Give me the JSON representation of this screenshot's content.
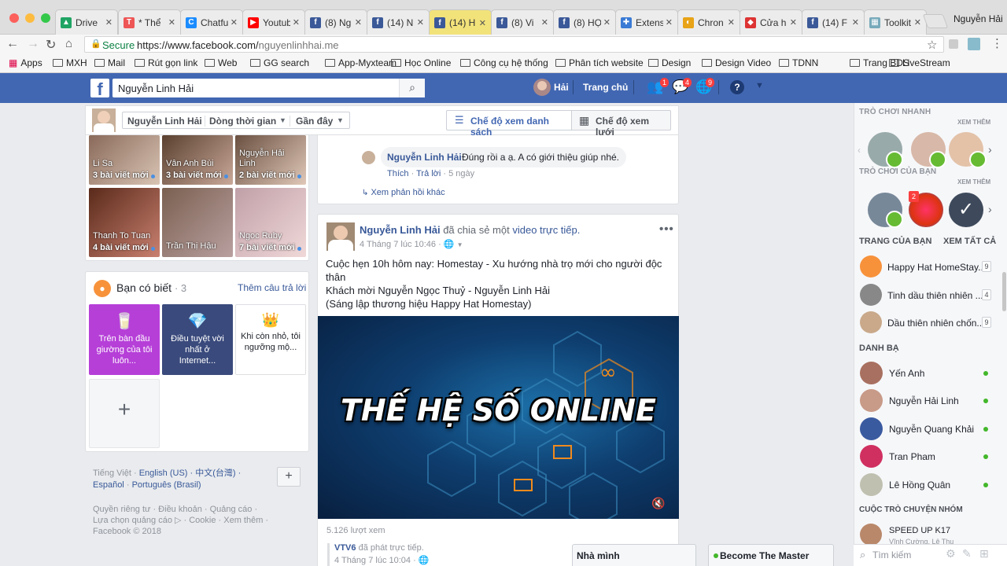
{
  "tabs": [
    {
      "label": "Drive",
      "color": "#1fa463",
      "glyph": "▲"
    },
    {
      "label": "* Thể",
      "color": "#e55",
      "glyph": "T"
    },
    {
      "label": "Chatfu",
      "color": "#1a8cff",
      "glyph": "C"
    },
    {
      "label": "Youtub",
      "color": "#f00",
      "glyph": "▶"
    },
    {
      "label": "(8) Ng",
      "color": "#3b5998",
      "glyph": "f"
    },
    {
      "label": "(14) N",
      "color": "#3b5998",
      "glyph": "f"
    },
    {
      "label": "(14) H",
      "color": "#3b5998",
      "glyph": "f"
    },
    {
      "label": "(8) Vi",
      "color": "#3b5998",
      "glyph": "f"
    },
    {
      "label": "(8) HỌ",
      "color": "#3b5998",
      "glyph": "f"
    },
    {
      "label": "Extens",
      "color": "#3a7bd5",
      "glyph": "✚"
    },
    {
      "label": "Chron",
      "color": "#e8a317",
      "glyph": "◐"
    },
    {
      "label": "Cửa h",
      "color": "#d33",
      "glyph": "◆"
    },
    {
      "label": "(14) F",
      "color": "#3b5998",
      "glyph": "f"
    },
    {
      "label": "Toolkit",
      "color": "#7ab",
      "glyph": "▦"
    }
  ],
  "profile_name": "Nguyễn Hải",
  "url": {
    "secure": "Secure",
    "prefix": "https://www.facebook.com/",
    "path": "nguyenlinhhai.me"
  },
  "bookmarks": [
    "Apps",
    "MXH",
    "Mail",
    "Rút gọn link",
    "Web",
    "GG search",
    "App-Myxteam",
    "Học Online",
    "Công cụ hệ thống",
    "Phân tích website",
    "Design",
    "Design Video",
    "TDNN",
    "Trang BDS",
    "LiveStream"
  ],
  "fb": {
    "search_value": "Nguyễn Linh Hải",
    "user": "Hải",
    "home": "Trang chủ",
    "badges": {
      "friends": "1",
      "messages": "4",
      "notifications": "9"
    }
  },
  "timeline": {
    "name": "Nguyễn Linh Hải",
    "filter": "Dòng thời gian",
    "sort": "Gần đây",
    "list_view": "Chế độ xem danh sách",
    "grid_view": "Chế độ xem lưới"
  },
  "friends": [
    {
      "name": "Li Sa",
      "posts": "3 bài viết mới"
    },
    {
      "name": "Vân Anh Bùi",
      "posts": "3 bài viết mới"
    },
    {
      "name": "Nguyễn Hải Linh",
      "posts": "2 bài viết mới"
    },
    {
      "name": "Thanh To Tuan",
      "posts": "4 bài viết mới"
    },
    {
      "name": "Trần Thị Hậu",
      "posts": ""
    },
    {
      "name": "Ngọc Ruby",
      "posts": "7 bài viết mới"
    }
  ],
  "ask": {
    "title": "Bạn có biết",
    "count": "· 3",
    "more": "Thêm câu trả lời",
    "cards": [
      "Trên bàn đầu giường của tôi luôn...",
      "Điều tuyệt vời nhất ở Internet...",
      "Khi còn nhỏ, tôi ngưỡng mộ..."
    ]
  },
  "languages": {
    "current": "Tiếng Việt ·",
    "list": [
      "English (US) ·",
      "中文(台灣) ·",
      "Español",
      "Português (Brasil)"
    ]
  },
  "footer": {
    "line1": "Quyền riêng tư · Điều khoản · Quảng cáo ·",
    "line2": "Lựa chọn quảng cáo ▷ · Cookie · Xem thêm ·",
    "copyright": "Facebook © 2018"
  },
  "comment": {
    "author": "Nguyễn Linh Hải",
    "text": "Đúng rồi a ạ. A có giới thiệu giúp nhé.",
    "like": "Thích",
    "reply": "Trả lời",
    "time": "5 ngày",
    "more_replies": "Xem phản hồi khác"
  },
  "post": {
    "author": "Nguyễn Linh Hải",
    "action": "đã chia sẻ một",
    "object": "video trực tiếp.",
    "time": "4 Tháng 7 lúc 10:46 ·",
    "line1": "Cuộc hẹn 10h hôm nay: Homestay - Xu hướng nhà trọ mới cho người độc thân",
    "line2": "Khách mời Nguyễn Ngọc Thuỷ - Nguyễn Linh Hải",
    "line3": "(Sáng lập thương hiệu Happy Hat Homestay)",
    "video_title": "THẾ HỆ SỐ ONLINE",
    "views": "5.126 lượt xem",
    "shared_page": "VTV6",
    "shared_action": "đã phát trực tiếp.",
    "shared_time": "4 Tháng 7 lúc 10:04 ·"
  },
  "right": {
    "quick_games": "TRÒ CHƠI NHANH",
    "see_more1": "XEM THÊM",
    "your_games": "TRÒ CHƠI CỦA BẠN",
    "see_more2": "XEM THÊM",
    "game_badge": "2",
    "pages_title": "TRANG CỦA BẠN",
    "see_all": "XEM TẤT CẢ",
    "pages": [
      {
        "name": "Happy Hat HomeStay...",
        "count": "9"
      },
      {
        "name": "Tinh dầu thiên nhiên ...",
        "count": "4"
      },
      {
        "name": "Dầu thiên nhiên chốn...",
        "count": "9"
      }
    ],
    "contacts_title": "DANH BẠ",
    "contacts": [
      "Yến Anh",
      "Nguyễn Hải Linh",
      "Nguyễn Quang Khải",
      "Tran Pham",
      "Lê Hồng Quân"
    ],
    "groups_title": "CUỘC TRÒ CHUYỆN NHÓM",
    "group_name": "SPEED UP K17",
    "group_members": "Vĩnh Cường, Lê Thu",
    "search_placeholder": "Tìm kiếm"
  },
  "chat": {
    "tab1": "Nhà mình",
    "tab2": "Become The Master"
  }
}
